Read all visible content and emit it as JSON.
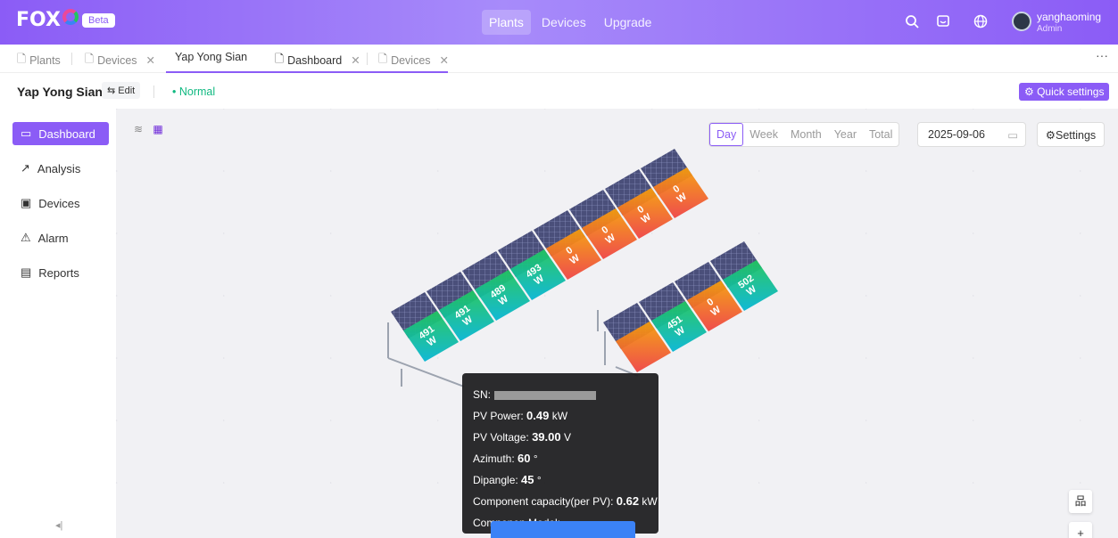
{
  "app": {
    "logo_text": "FOX",
    "beta_label": "Beta"
  },
  "topnav": {
    "items": [
      "Plants",
      "Devices",
      "Upgrade"
    ]
  },
  "user": {
    "name": "yanghaoming",
    "role": "Admin"
  },
  "tabs": [
    {
      "label": "Plants",
      "closable": false
    },
    {
      "label": "Devices",
      "closable": true
    },
    {
      "label": "Yap Yong Sian",
      "closable": false
    },
    {
      "label": "Dashboard",
      "closable": true
    },
    {
      "label": "Devices",
      "closable": true
    }
  ],
  "header": {
    "plant_name": "Yap Yong Sian",
    "edit_label": "Edit",
    "status": "Normal",
    "quick_settings_label": "Quick settings"
  },
  "sidebar": {
    "items": [
      "Dashboard",
      "Analysis",
      "Devices",
      "Alarm",
      "Reports"
    ]
  },
  "periods": [
    "Day",
    "Week",
    "Month",
    "Year",
    "Total"
  ],
  "date_value": "2025-09-06",
  "settings_label": "Settings",
  "panels_row1": [
    {
      "power": "491",
      "unit": "W",
      "state": "green"
    },
    {
      "power": "491",
      "unit": "W",
      "state": "green"
    },
    {
      "power": "489",
      "unit": "W",
      "state": "green"
    },
    {
      "power": "493",
      "unit": "W",
      "state": "green"
    },
    {
      "power": "0",
      "unit": "W",
      "state": "red"
    },
    {
      "power": "0",
      "unit": "W",
      "state": "red"
    },
    {
      "power": "0",
      "unit": "W",
      "state": "red"
    },
    {
      "power": "0",
      "unit": "W",
      "state": "red"
    }
  ],
  "panels_row2": [
    {
      "power": "",
      "unit": "",
      "state": "red"
    },
    {
      "power": "451",
      "unit": "W",
      "state": "green"
    },
    {
      "power": "0",
      "unit": "W",
      "state": "red"
    },
    {
      "power": "502",
      "unit": "W",
      "state": "green"
    }
  ],
  "tooltip": {
    "sn_label": "SN:",
    "pv_power_label": "PV Power:",
    "pv_power_value": "0.49",
    "pv_power_unit": "kW",
    "pv_voltage_label": "PV Voltage:",
    "pv_voltage_value": "39.00",
    "pv_voltage_unit": "V",
    "azimuth_label": "Azimuth:",
    "azimuth_value": "60",
    "azimuth_unit": "°",
    "dipangle_label": "Dipangle:",
    "dipangle_value": "45",
    "dipangle_unit": "°",
    "capacity_label": "Component capacity(per PV):",
    "capacity_value": "0.62",
    "capacity_unit": "kW",
    "model_label": "Componen Model:"
  },
  "colors": {
    "accent": "#8b5cf6",
    "normal": "#10b981",
    "panel_green": "#22c55e",
    "panel_red": "#ef4444"
  }
}
